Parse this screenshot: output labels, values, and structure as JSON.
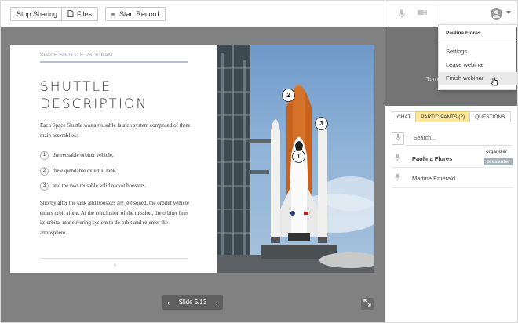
{
  "toolbar": {
    "stop_sharing": "Stop Sharing",
    "files": "Files",
    "start_record": "Start Record"
  },
  "slide": {
    "program": "SPACE SHUTTLE PROGRAM",
    "title_line1": "SHUTTLE",
    "title_line2": "DESCRIPTION",
    "intro": "Each Space Shuttle was a reusable launch system composed of three main assemblies:",
    "items": [
      {
        "num": "1",
        "text": "the reusable orbiter vehicle,"
      },
      {
        "num": "2",
        "text": "the expendable external tank,"
      },
      {
        "num": "3",
        "text": "and the two reusable solid rocket boosters."
      }
    ],
    "outro": "Shortly after the tank and boosters are jettisoned, the orbiter vehicle enters orbit alone. At the conclusion of the mission, the orbiter fires its orbital maneuvering system to de-orbit and re-enter the atmosphere.",
    "page_number": "4",
    "markers": [
      "2",
      "3",
      "1"
    ]
  },
  "slide_nav": {
    "label": "Slide 5/13",
    "prev": "‹",
    "next": "›"
  },
  "video": {
    "partial_text": "Turn"
  },
  "tabs": [
    {
      "label": "CHAT",
      "active": false
    },
    {
      "label": "PARTICIPANTS (2)",
      "active": true
    },
    {
      "label": "QUESTIONS",
      "active": false
    }
  ],
  "search": {
    "placeholder": "Search..."
  },
  "participants": [
    {
      "name": "Paulina Flores",
      "roles": [
        "organizer",
        "presenter"
      ]
    },
    {
      "name": "Martina Emerald",
      "roles": []
    }
  ],
  "user_menu": {
    "username": "Paulina Flores",
    "items": [
      "Settings",
      "Leave webinar",
      "Finish webinar"
    ],
    "hovered": "Finish webinar"
  },
  "colors": {
    "stage_bg": "#818181",
    "active_tab": "#fbe69a",
    "presenter_badge": "#a2b0b8"
  }
}
